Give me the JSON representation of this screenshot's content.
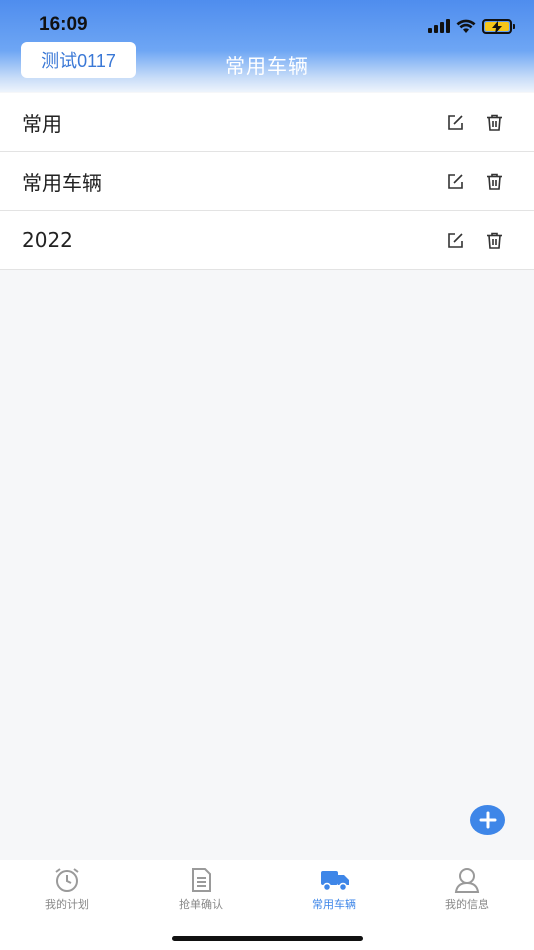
{
  "status_bar": {
    "time": "16:09"
  },
  "header": {
    "account_chip": "测试0117",
    "title": "常用车辆"
  },
  "vehicle_groups": [
    {
      "name": "常用"
    },
    {
      "name": "常用车辆"
    },
    {
      "name": "2022"
    }
  ],
  "tabbar": {
    "tabs": [
      {
        "label": "我的计划",
        "icon": "alarm-clock-icon"
      },
      {
        "label": "抢单确认",
        "icon": "document-icon"
      },
      {
        "label": "常用车辆",
        "icon": "truck-icon"
      },
      {
        "label": "我的信息",
        "icon": "user-icon"
      }
    ],
    "active_index": 2
  },
  "colors": {
    "accent": "#3e86e8",
    "header_top": "#4f8dee",
    "background": "#f6f7f9"
  }
}
